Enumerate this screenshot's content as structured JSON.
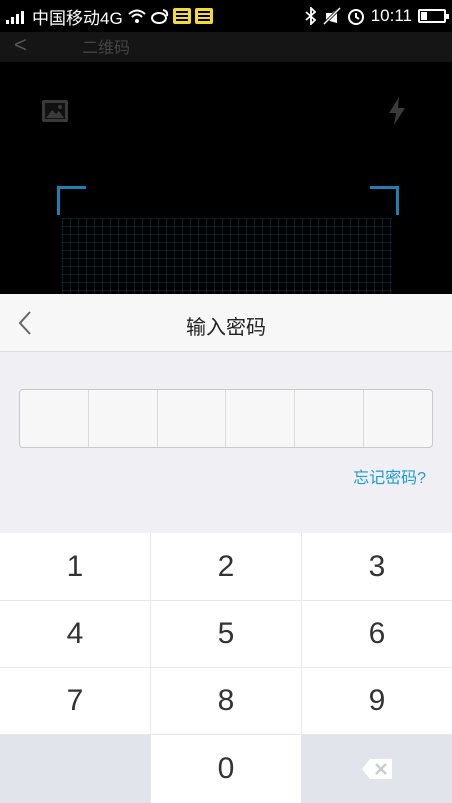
{
  "status_bar": {
    "carrier": "中国移动4G",
    "time": "10:11",
    "icons": [
      "signal-icon",
      "wifi-icon",
      "weibo-icon",
      "yellow-app-icon",
      "yellow-app-icon",
      "bluetooth-icon",
      "mute-icon",
      "alarm-icon",
      "battery-icon"
    ],
    "battery_level": 0.25
  },
  "camera": {
    "header_title": "二维码",
    "icons": [
      "gallery-icon",
      "flash-icon"
    ],
    "frame_color": "#1f7fb0"
  },
  "password_sheet": {
    "title": "输入密码",
    "forgot_label": "忘记密码?",
    "digit_count": 6,
    "entered_digits": 0
  },
  "keypad": {
    "keys": [
      "1",
      "2",
      "3",
      "4",
      "5",
      "6",
      "7",
      "8",
      "9",
      "",
      "0",
      "backspace-icon"
    ]
  },
  "colors": {
    "accent": "#1c9bd8",
    "sheet_bg": "#efeff4",
    "key_bg": "#ffffff",
    "blank_key_bg": "#e1e4ea"
  }
}
